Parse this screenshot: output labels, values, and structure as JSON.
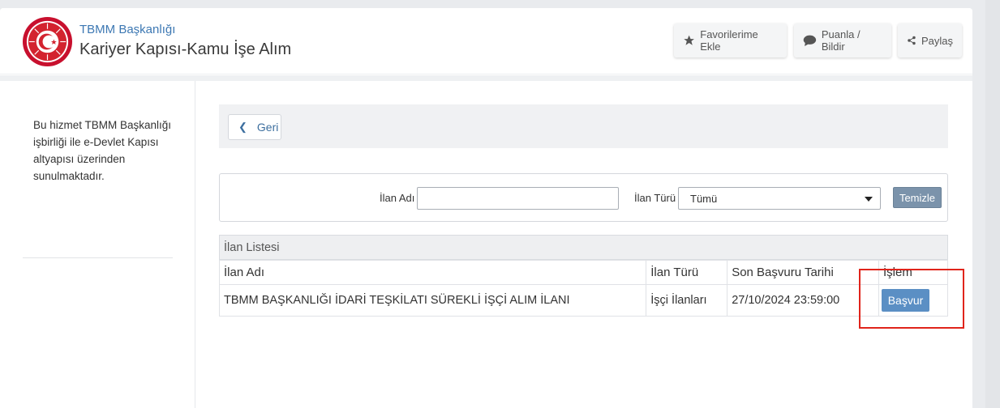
{
  "header": {
    "org_link": "TBMM Başkanlığı",
    "app_title": "Kariyer Kapısı-Kamu İşe Alım",
    "actions": {
      "favorite": "Favorilerime Ekle",
      "rate": "Puanla / Bildir",
      "share": "Paylaş"
    }
  },
  "sidebar": {
    "info": "Bu hizmet TBMM Başkanlığı işbirliği ile e-Devlet Kapısı altyapısı üzerinden sunulmaktadır."
  },
  "main": {
    "back_label": "Geri",
    "filters": {
      "name_label": "İlan Adı",
      "name_value": "",
      "type_label": "İlan Türü",
      "type_value": "Tümü",
      "clear_label": "Temizle"
    },
    "list": {
      "title": "İlan Listesi",
      "columns": [
        "İlan Adı",
        "İlan Türü",
        "Son Başvuru Tarihi",
        "İşlem"
      ],
      "rows": [
        {
          "name": "TBMM BAŞKANLIĞI İDARİ TEŞKİLATI SÜREKLİ İŞÇİ ALIM İLANI",
          "type": "İşçi İlanları",
          "deadline": "27/10/2024 23:59:00",
          "action": "Başvur"
        }
      ]
    }
  },
  "colors": {
    "accent": "#3d78b3",
    "apply_button": "#5b8fc4",
    "highlight_box": "#e0241b"
  }
}
